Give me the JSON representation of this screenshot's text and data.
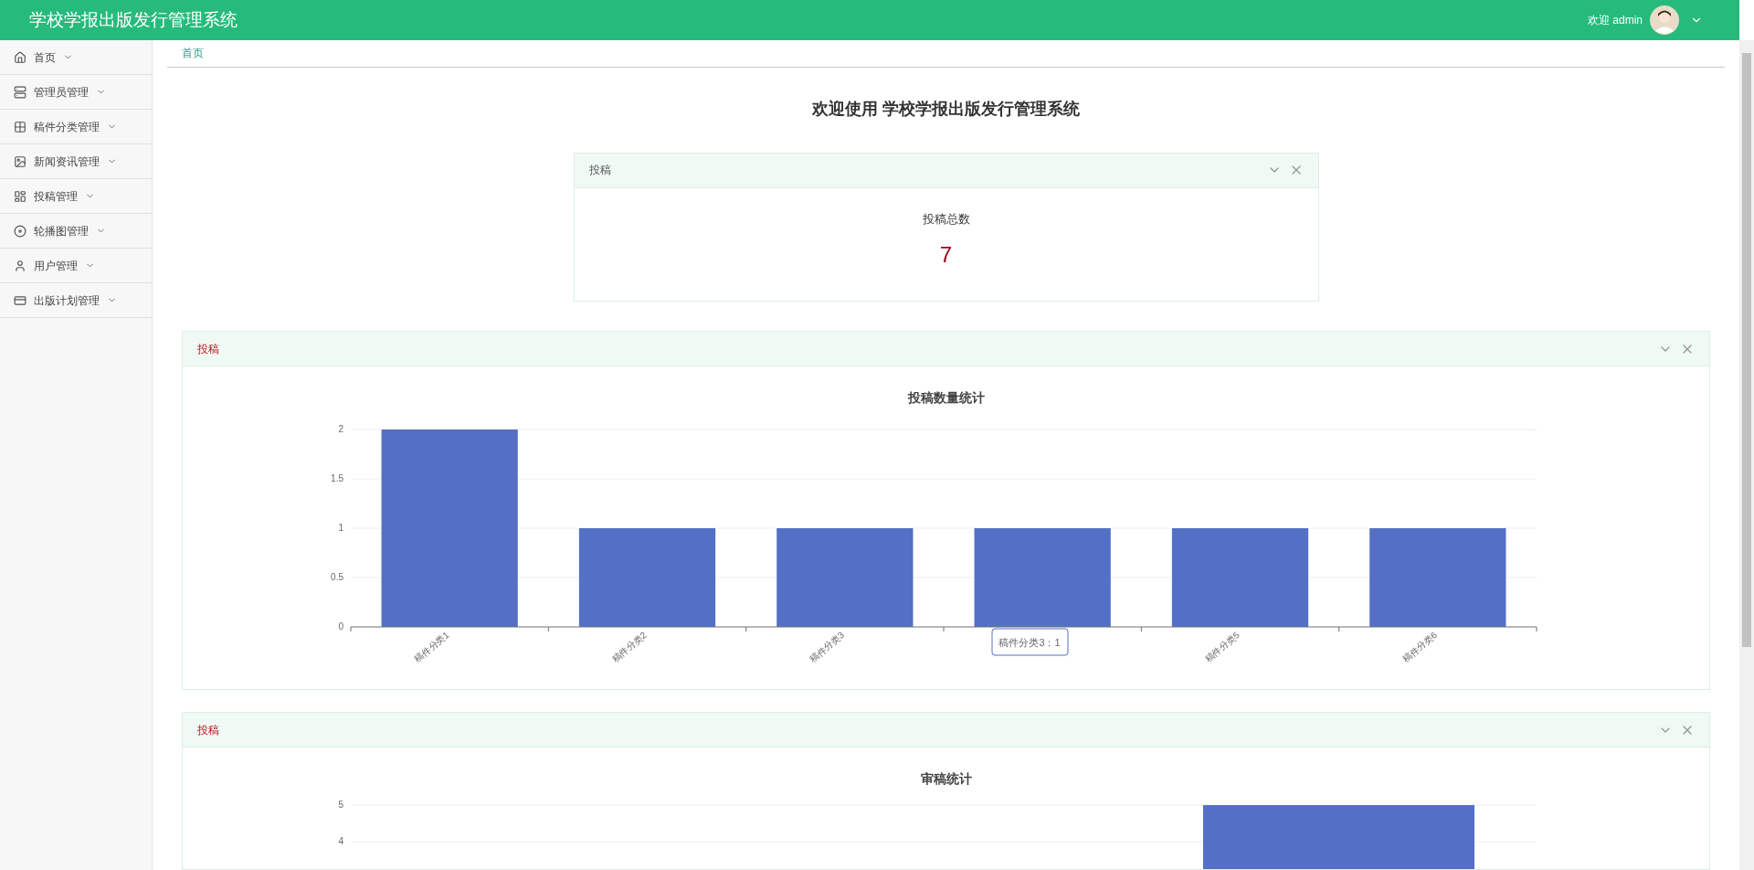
{
  "header": {
    "title": "学校学报出版发行管理系统",
    "welcome": "欢迎 admin"
  },
  "sidebar": {
    "items": [
      {
        "label": "首页"
      },
      {
        "label": "管理员管理"
      },
      {
        "label": "稿件分类管理"
      },
      {
        "label": "新闻资讯管理"
      },
      {
        "label": "投稿管理"
      },
      {
        "label": "轮播图管理"
      },
      {
        "label": "用户管理"
      },
      {
        "label": "出版计划管理"
      }
    ]
  },
  "breadcrumb": "首页",
  "page_title": "欢迎使用 学校学报出版发行管理系统",
  "panels": [
    {
      "kind": "stat",
      "title": "投稿",
      "accent": false,
      "stat_label": "投稿总数",
      "stat_value": "7"
    },
    {
      "kind": "chart",
      "title": "投稿",
      "accent": true,
      "chart_data": {
        "type": "bar",
        "title": "投稿数量统计",
        "categories": [
          "稿件分类1",
          "稿件分类2",
          "稿件分类3",
          null,
          "稿件分类5",
          "稿件分类6"
        ],
        "values": [
          2,
          1,
          1,
          1,
          1,
          1
        ],
        "ylim": [
          0,
          2
        ],
        "yticks": [
          0,
          0.5,
          1,
          1.5,
          2
        ],
        "grid": true
      },
      "tooltip": "稿件分类3：1"
    },
    {
      "kind": "partial_chart",
      "title": "投稿",
      "accent": true,
      "chart_title": "审稿统计",
      "tick_labels": [
        "5",
        "4"
      ]
    }
  ]
}
